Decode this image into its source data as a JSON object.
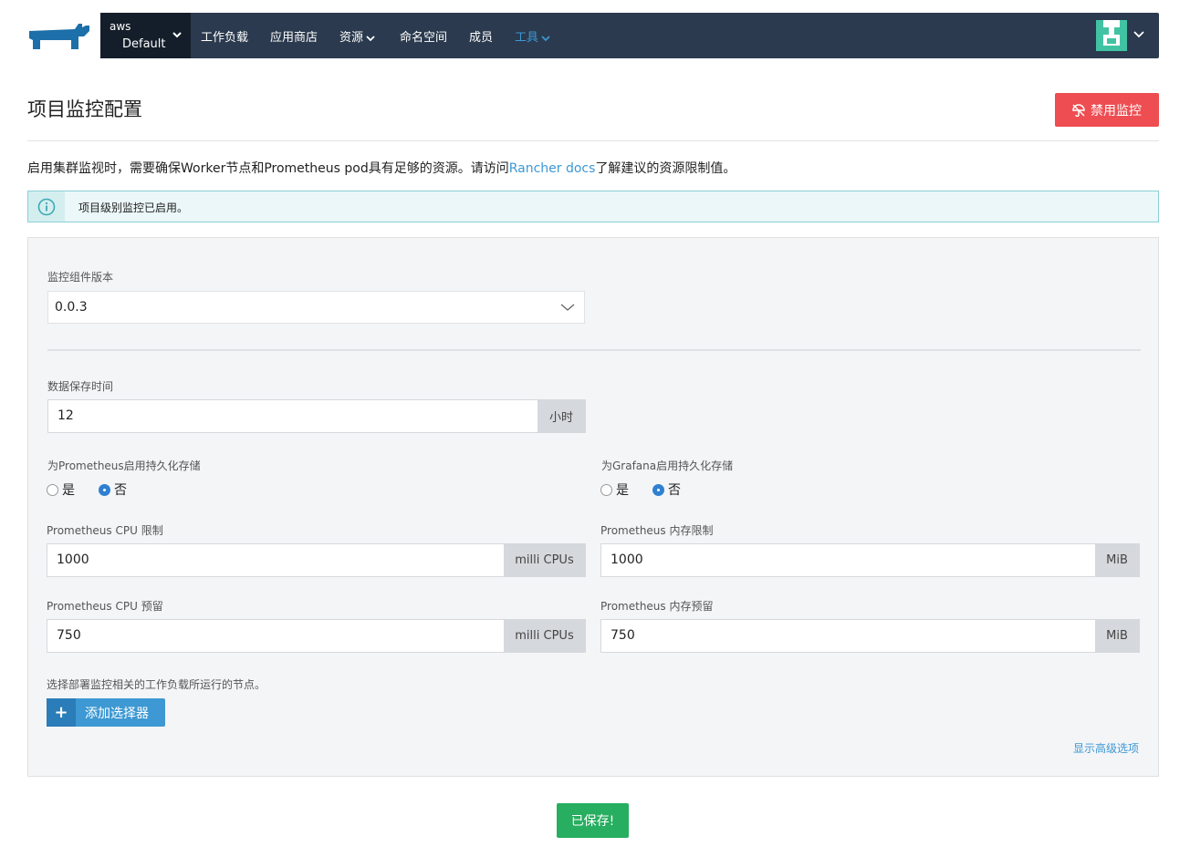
{
  "nav": {
    "cluster_name": "aws",
    "project_name": "Default",
    "items": [
      {
        "label": "工作负载"
      },
      {
        "label": "应用商店"
      },
      {
        "label": "资源"
      },
      {
        "label": "命名空间"
      },
      {
        "label": "成员"
      },
      {
        "label": "工具"
      }
    ],
    "active_item": "工具"
  },
  "header": {
    "title": "项目监控配置",
    "disable_button": "禁用监控"
  },
  "description": {
    "prefix": "启用集群监视时，需要确保Worker节点和Prometheus pod具有足够的资源。请访问",
    "link": "Rancher docs",
    "suffix": "了解建议的资源限制值。"
  },
  "banner": {
    "text": "项目级别监控已启用。"
  },
  "form": {
    "version_label": "监控组件版本",
    "version_value": "0.0.3",
    "retention_label": "数据保存时间",
    "retention_value": "12",
    "retention_unit": "小时",
    "prom_storage_label": "为Prometheus启用持久化存储",
    "grafana_storage_label": "为Grafana启用持久化存储",
    "yes": "是",
    "no": "否",
    "prom_storage_selected": "否",
    "grafana_storage_selected": "否",
    "cpu_limit_label": "Prometheus CPU 限制",
    "cpu_limit_value": "1000",
    "cpu_unit": "milli CPUs",
    "mem_limit_label": "Prometheus 内存限制",
    "mem_limit_value": "1000",
    "mem_unit": "MiB",
    "cpu_reserve_label": "Prometheus CPU 预留",
    "cpu_reserve_value": "750",
    "mem_reserve_label": "Prometheus 内存预留",
    "mem_reserve_value": "750",
    "node_selector_label": "选择部署监控相关的工作负载所运行的节点。",
    "add_selector_button": "添加选择器",
    "advanced_link": "显示高级选项"
  },
  "footer": {
    "save_button": "已保存!"
  },
  "colors": {
    "nav_bg": "#2b3a4e",
    "accent": "#3d98d3",
    "danger": "#ee4d52",
    "success": "#27ae60"
  }
}
